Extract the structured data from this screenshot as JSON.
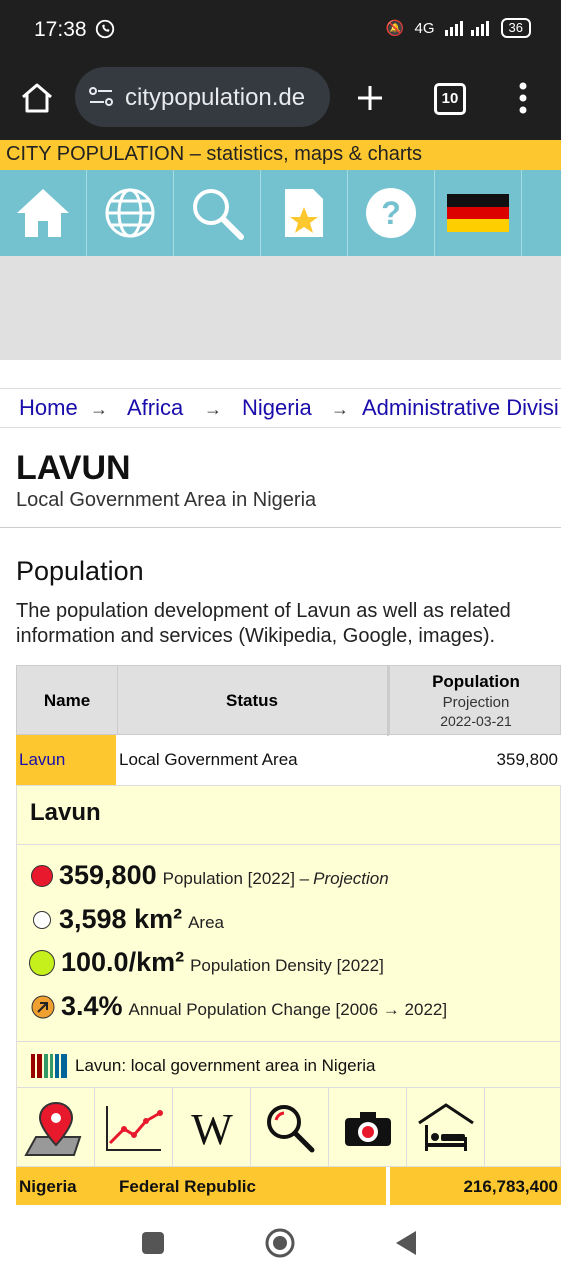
{
  "status_bar": {
    "time": "17:38",
    "network": "4G",
    "battery": "36"
  },
  "browser": {
    "url": "citypopulation.de",
    "tab_count": "10"
  },
  "site": {
    "banner": "CITY POPULATION – statistics, maps & charts"
  },
  "breadcrumb": {
    "items": [
      "Home",
      "Africa",
      "Nigeria",
      "Administrative Divisi"
    ],
    "separator": "→"
  },
  "page": {
    "title": "LAVUN",
    "subtitle": "Local Government Area in Nigeria",
    "section_title": "Population",
    "intro": "The population development of Lavun as well as related information and services (Wikipedia, Google, images)."
  },
  "table": {
    "headers": {
      "name": "Name",
      "status": "Status",
      "population": "Population",
      "population_sub1": "Projection",
      "population_sub2": "2022-03-21"
    },
    "row1": {
      "name": "Lavun",
      "status": "Local Government Area",
      "population": "359,800"
    },
    "row2": {
      "name": "Nigeria",
      "status": "Federal Republic",
      "population": "216,783,400"
    }
  },
  "panel": {
    "title": "Lavun",
    "stats": [
      {
        "value": "359,800",
        "label": "Population [2022] –",
        "label_em": "Projection",
        "color": "#e8192c"
      },
      {
        "value": "3,598 km²",
        "label": "Area",
        "color": "#ffffff"
      },
      {
        "value": "100.0/km²",
        "label": "Population Density [2022]",
        "color": "#c6f01c"
      },
      {
        "value": "3.4%",
        "label": "Annual Population Change [2006 → 2022]",
        "color": "#f0a030"
      }
    ],
    "wiki_text": "Lavun: local government area in Nigeria",
    "icons": [
      "map-pin-icon",
      "line-chart-icon",
      "wikipedia-icon",
      "search-icon",
      "camera-icon",
      "hotel-icon"
    ]
  },
  "colors": {
    "accent_yellow": "#fdc82f",
    "nav_teal": "#74c2cf",
    "link": "#1a0dab",
    "panel_bg": "#ffffd6"
  }
}
